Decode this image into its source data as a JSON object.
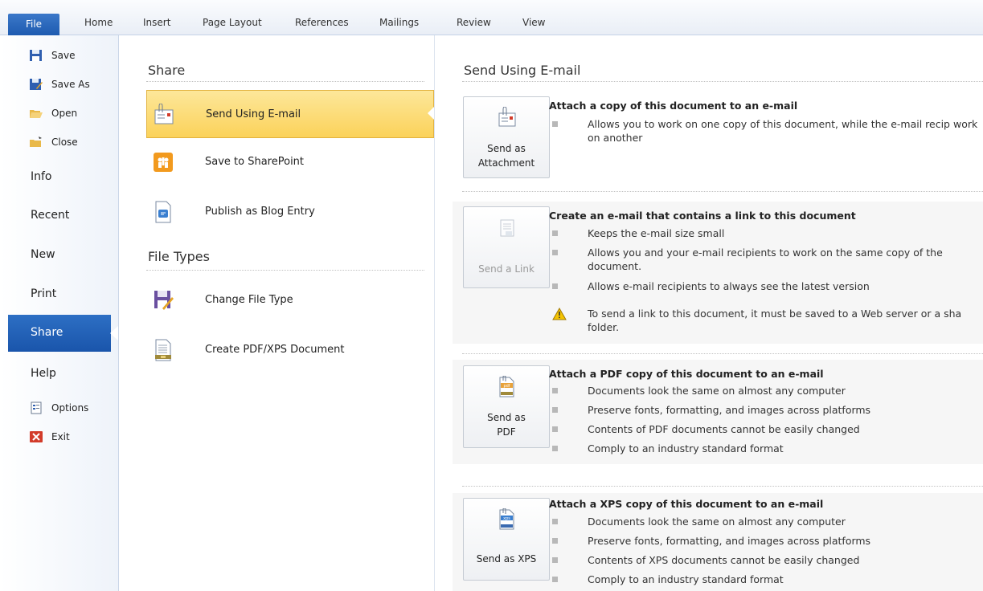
{
  "ribbon": {
    "tabs": [
      "File",
      "Home",
      "Insert",
      "Page Layout",
      "References",
      "Mailings",
      "Review",
      "View"
    ]
  },
  "leftnav": {
    "save": "Save",
    "save_as": "Save As",
    "open": "Open",
    "close": "Close",
    "info": "Info",
    "recent": "Recent",
    "new": "New",
    "print": "Print",
    "share": "Share",
    "help": "Help",
    "options": "Options",
    "exit": "Exit"
  },
  "share_col": {
    "heading": "Share",
    "items": [
      {
        "label": "Send Using E-mail",
        "icon": "email-envelope-icon"
      },
      {
        "label": "Save to SharePoint",
        "icon": "sharepoint-icon"
      },
      {
        "label": "Publish as Blog Entry",
        "icon": "blog-icon"
      }
    ],
    "file_types_heading": "File Types",
    "file_types": [
      {
        "label": "Change File Type",
        "icon": "change-file-type-icon"
      },
      {
        "label": "Create PDF/XPS Document",
        "icon": "pdf-xps-document-icon"
      }
    ]
  },
  "send_pane": {
    "title": "Send Using E-mail",
    "attachment": {
      "button": "Send as Attachment",
      "button_line1": "Send as",
      "button_line2": "Attachment",
      "heading": "Attach a copy of this document to an e-mail",
      "bullets": [
        "Allows you to work on one copy of this document, while the e-mail recip work on another"
      ]
    },
    "link": {
      "button": "Send a Link",
      "heading": "Create an e-mail that contains a link to this document",
      "bullets": [
        "Keeps the e-mail size small",
        "Allows you and your e-mail recipients to work on the same copy of the document.",
        "Allows e-mail recipients to always see the latest version"
      ],
      "warning": "To send a link to this document, it must be saved to a Web server or a sha folder."
    },
    "pdf": {
      "button_line1": "Send as",
      "button_line2": "PDF",
      "heading": "Attach a PDF copy of this document to an e-mail",
      "bullets": [
        "Documents look the same on almost any computer",
        "Preserve fonts, formatting, and images across platforms",
        "Contents of PDF documents cannot be easily changed",
        "Comply to an industry standard format"
      ]
    },
    "xps": {
      "button": "Send as XPS",
      "heading": "Attach a XPS copy of this document to an e-mail",
      "bullets": [
        "Documents look the same on almost any computer",
        "Preserve fonts, formatting, and images across platforms",
        "Contents of XPS documents cannot be easily changed",
        "Comply to an industry standard format"
      ]
    }
  },
  "colors": {
    "accent": "#1e5bb0",
    "selected_bg": "#fbd25a",
    "warning": "#f5c400"
  }
}
